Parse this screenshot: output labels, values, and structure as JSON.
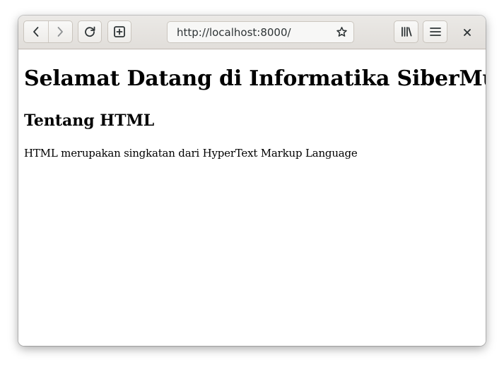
{
  "browser": {
    "url": "http://localhost:8000/",
    "icons": {
      "back": "chevron-left-icon",
      "forward": "chevron-right-icon",
      "reload": "reload-icon",
      "new_tab": "new-tab-icon",
      "bookmark": "star-icon",
      "library": "library-icon",
      "menu": "hamburger-menu-icon",
      "close": "close-icon"
    }
  },
  "page": {
    "heading": "Selamat Datang di Informatika SiberMu",
    "subheading": "Tentang HTML",
    "paragraph": "HTML merupakan singkatan dari HyperText Markup Language"
  },
  "colors": {
    "toolbar": "#e4e1dd",
    "content_bg": "#ffffff",
    "text": "#000000"
  }
}
